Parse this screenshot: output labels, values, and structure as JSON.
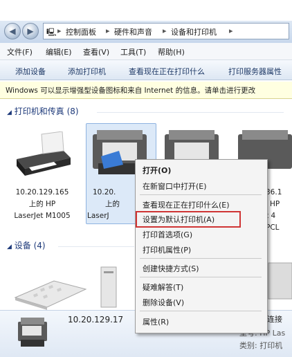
{
  "address": {
    "crumbs": [
      "控制面板",
      "硬件和声音",
      "设备和打印机"
    ]
  },
  "menubar": {
    "items": [
      "文件(F)",
      "编辑(E)",
      "查看(V)",
      "工具(T)",
      "帮助(H)"
    ]
  },
  "commandbar": {
    "items": [
      "添加设备",
      "添加打印机",
      "查看现在正在打印什么",
      "打印服务器属性"
    ]
  },
  "infobar": {
    "text": "Windows 可以显示增强型设备图标和来自 Internet 的信息。请单击进行更改"
  },
  "groups": {
    "printers": {
      "title": "打印机和传真 (8)"
    },
    "devices": {
      "title": "设备 (4)"
    }
  },
  "printers": [
    {
      "line1": "10.20.129.165",
      "line2": "上的 HP",
      "line3": "LaserJet M1005"
    },
    {
      "line1": "10.20.",
      "line2": "上的",
      "line3": "LaserJ"
    },
    {
      "line1": "36.1",
      "line2": "HP",
      "line3": "t 4",
      "line4": "PCL"
    }
  ],
  "context_menu": {
    "items": [
      {
        "label": "打开(O)",
        "bold": true
      },
      {
        "label": "在新窗口中打开(E)"
      },
      {
        "label": "查看现在正在打印什么(E)"
      },
      {
        "label": "设置为默认打印机(A)"
      },
      {
        "label": "打印首选项(G)"
      },
      {
        "label": "打印机属性(P)"
      },
      {
        "label": "创建快捷方式(S)"
      },
      {
        "label": "疑难解答(T)"
      },
      {
        "label": "删除设备(V)"
      },
      {
        "label": "属性(R)"
      }
    ]
  },
  "details": {
    "device_name": "10.20.129.17",
    "right_text1": "连接",
    "right_text2": "型号: HP Las",
    "right_text3": "类别: 打印机"
  },
  "colors": {
    "highlight_box": "#cf3434",
    "accent_text": "#1e3966"
  }
}
